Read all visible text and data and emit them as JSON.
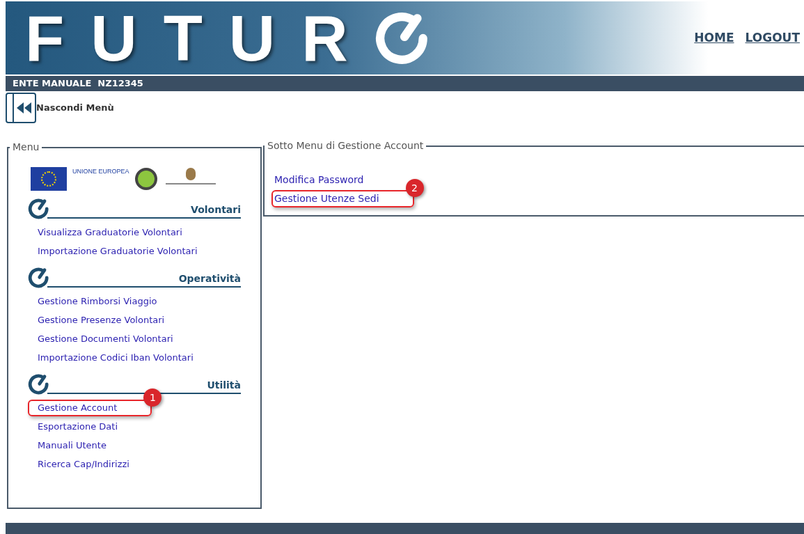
{
  "header": {
    "logo_text": "FUTUR",
    "nav": [
      "HOME",
      "LOGOUT"
    ]
  },
  "user_bar": {
    "text": "ENTE MANUALE  NZ12345"
  },
  "toggle": {
    "label": "Nascondi Menù"
  },
  "menu": {
    "legend": "Menu",
    "eu_label": "UNIONE EUROPEA",
    "sections": [
      {
        "title": "Volontari",
        "items": [
          {
            "label": "Visualizza Graduatorie Volontari"
          },
          {
            "label": "Importazione Graduatorie Volontari"
          }
        ]
      },
      {
        "title": "Operatività",
        "items": [
          {
            "label": "Gestione Rimborsi Viaggio"
          },
          {
            "label": "Gestione Presenze Volontari"
          },
          {
            "label": "Gestione Documenti Volontari"
          },
          {
            "label": "Importazione Codici Iban Volontari"
          }
        ]
      },
      {
        "title": "Utilità",
        "items": [
          {
            "label": "Gestione Account",
            "callout": "1"
          },
          {
            "label": "Esportazione Dati"
          },
          {
            "label": "Manuali Utente"
          },
          {
            "label": "Ricerca Cap/Indirizzi"
          }
        ]
      }
    ]
  },
  "submenu": {
    "legend_prefix": "Sotto Menu di",
    "legend_context": "Gestione Account",
    "items": [
      {
        "label": "Modifica Password"
      },
      {
        "label": "Gestione Utenze Sedi",
        "callout": "2"
      }
    ]
  }
}
